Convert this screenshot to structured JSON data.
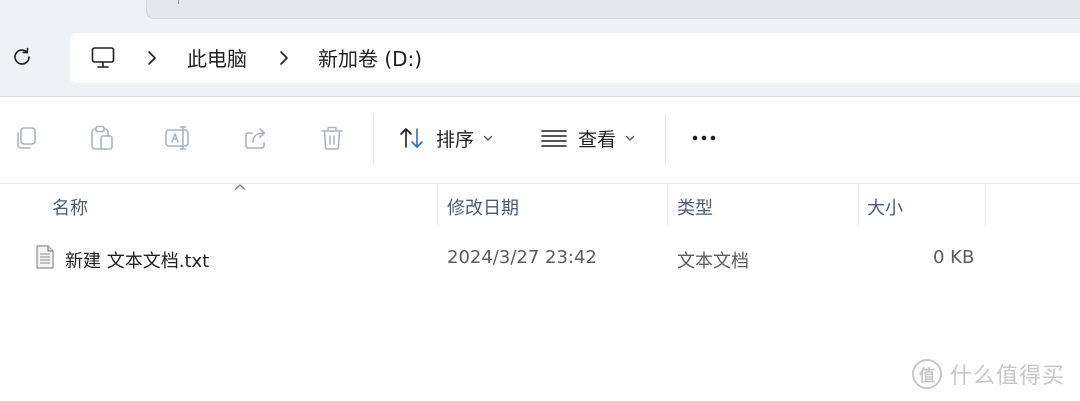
{
  "breadcrumb": {
    "root_icon": "computer-icon",
    "items": [
      "此电脑",
      "新加卷 (D:)"
    ]
  },
  "toolbar": {
    "icons": [
      "copy-icon",
      "paste-icon",
      "rename-icon",
      "share-icon",
      "delete-icon"
    ],
    "sort_label": "排序",
    "view_label": "查看",
    "more_label": "..."
  },
  "columns": {
    "name": "名称",
    "date": "修改日期",
    "type": "类型",
    "size": "大小"
  },
  "files": [
    {
      "name": "新建 文本文档.txt",
      "date": "2024/3/27 23:42",
      "type": "文本文档",
      "size": "0 KB",
      "icon": "text-file-icon"
    }
  ],
  "watermark": {
    "logo_text": "值",
    "text": "什么值得买"
  },
  "colors": {
    "chrome_bg": "#eef1f6",
    "header_text": "#4d5b72",
    "icon_accent": "#5b8fc7",
    "disabled_icon": "#a9b4c2"
  }
}
